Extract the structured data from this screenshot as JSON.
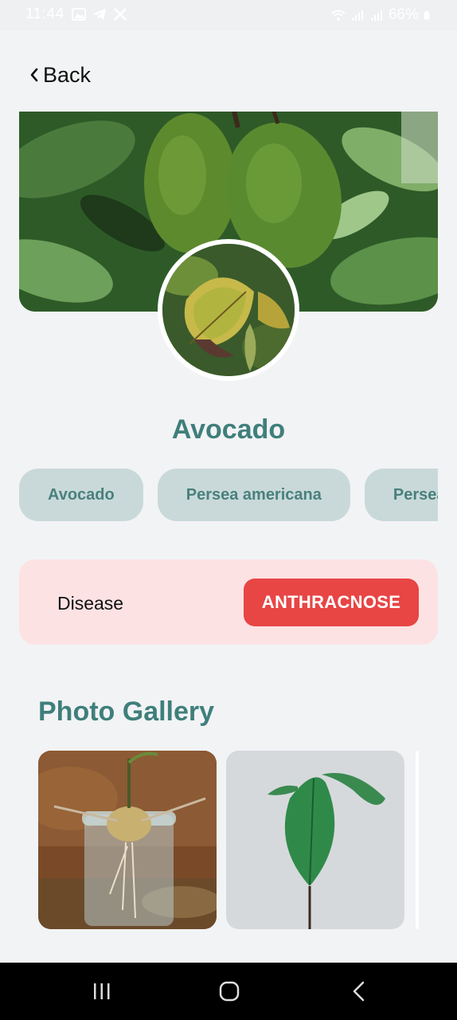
{
  "status_bar": {
    "time": "11:44",
    "battery": "66%"
  },
  "header": {
    "back_label": "Back"
  },
  "plant": {
    "name": "Avocado",
    "chips": [
      "Avocado",
      "Persea americana",
      "Persea"
    ]
  },
  "diagnosis": {
    "label": "Disease",
    "value": "ANTHRACNOSE",
    "badge_color": "#e84545"
  },
  "gallery": {
    "title": "Photo Gallery"
  },
  "colors": {
    "accent": "#3f7f7b",
    "chip_bg": "#c9d9da",
    "card_bg": "#fde2e3",
    "page_bg": "#f2f3f5"
  },
  "icons": {
    "back": "chevron-left-icon",
    "nav_recent": "recent-apps-icon",
    "nav_home": "home-icon",
    "nav_back": "back-icon"
  }
}
